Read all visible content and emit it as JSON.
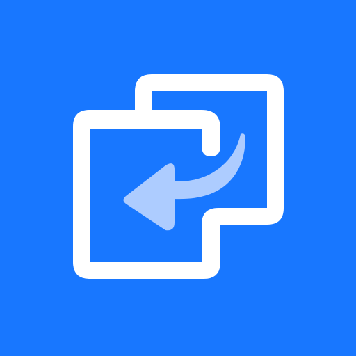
{
  "icon": {
    "name": "file-transfer-app-icon",
    "symbol": "overlapping-squares-with-return-arrow-icon"
  },
  "colors": {
    "background": "#1877FF",
    "outline": "#FFFFFF",
    "arrow": "#ADCCFF"
  }
}
